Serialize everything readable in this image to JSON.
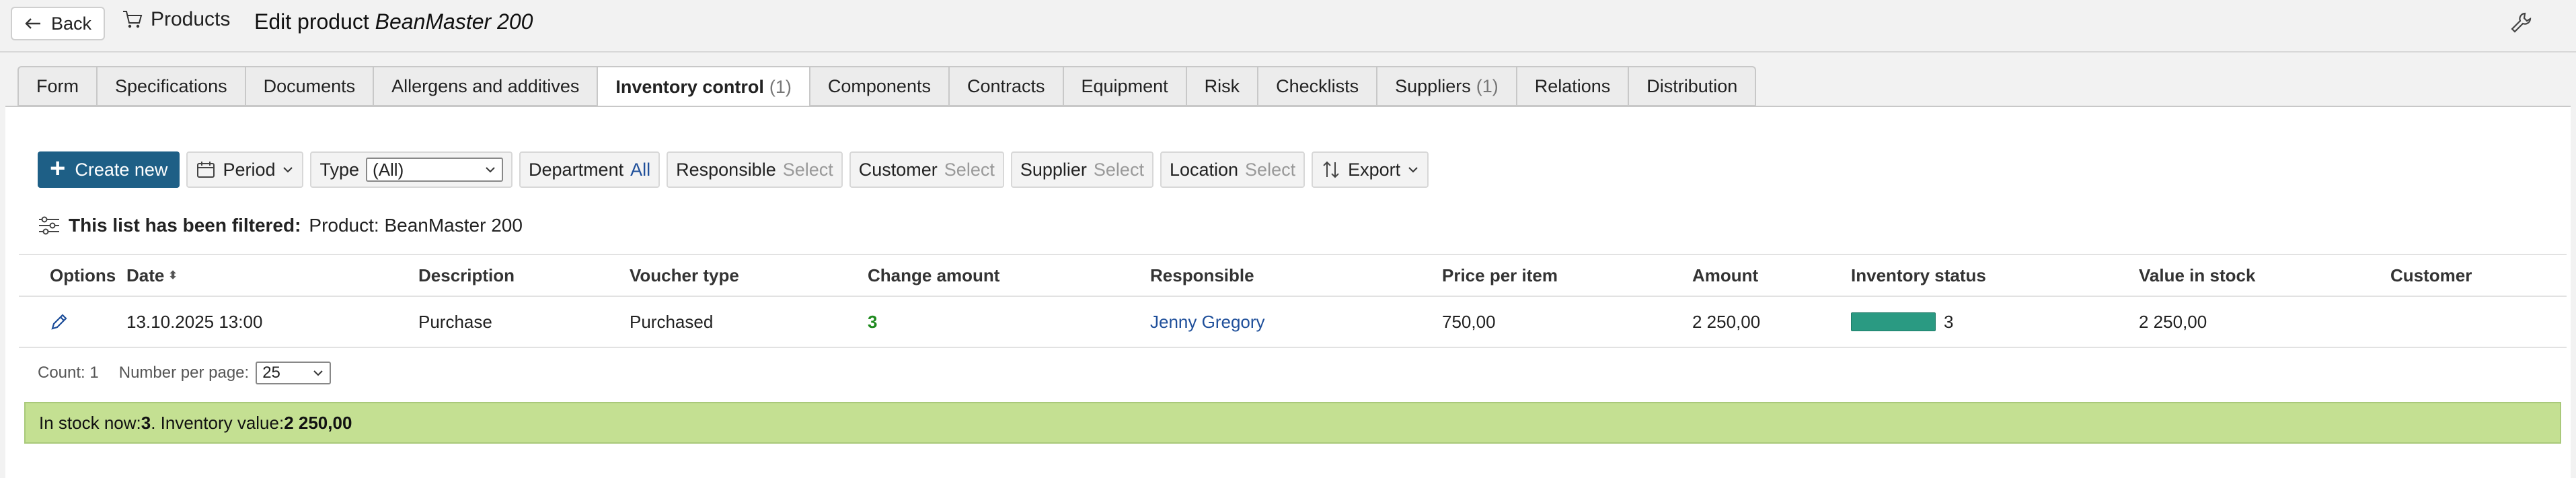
{
  "header": {
    "back_label": "Back",
    "breadcrumb": "Products",
    "title_prefix": "Edit product",
    "title_product": "BeanMaster 200"
  },
  "tabs": [
    {
      "label": "Form",
      "count": ""
    },
    {
      "label": "Specifications",
      "count": ""
    },
    {
      "label": "Documents",
      "count": ""
    },
    {
      "label": "Allergens and additives",
      "count": ""
    },
    {
      "label": "Inventory control",
      "count": "(1)",
      "active": true
    },
    {
      "label": "Components",
      "count": ""
    },
    {
      "label": "Contracts",
      "count": ""
    },
    {
      "label": "Equipment",
      "count": ""
    },
    {
      "label": "Risk",
      "count": ""
    },
    {
      "label": "Checklists",
      "count": ""
    },
    {
      "label": "Suppliers",
      "count": "(1)"
    },
    {
      "label": "Relations",
      "count": ""
    },
    {
      "label": "Distribution",
      "count": ""
    }
  ],
  "toolbar": {
    "create_label": "Create new",
    "period_label": "Period",
    "type_label": "Type",
    "type_value": "(All)",
    "department_label": "Department",
    "department_value": "All",
    "responsible_label": "Responsible",
    "responsible_value": "Select",
    "customer_label": "Customer",
    "customer_value": "Select",
    "supplier_label": "Supplier",
    "supplier_value": "Select",
    "location_label": "Location",
    "location_value": "Select",
    "export_label": "Export"
  },
  "filter_notice": {
    "label": "This list has been filtered:",
    "value": "Product: BeanMaster 200"
  },
  "table": {
    "headers": {
      "options": "Options",
      "date": "Date",
      "description": "Description",
      "voucher_type": "Voucher type",
      "change_amount": "Change amount",
      "responsible": "Responsible",
      "price_per_item": "Price per item",
      "amount": "Amount",
      "inventory_status": "Inventory status",
      "value_in_stock": "Value in stock",
      "customer": "Customer"
    },
    "rows": [
      {
        "date": "13.10.2025 13:00",
        "description": "Purchase",
        "voucher_type": "Purchased",
        "change_amount": "3",
        "responsible": "Jenny Gregory",
        "price_per_item": "750,00",
        "amount": "2 250,00",
        "inventory_status": "3",
        "value_in_stock": "2 250,00",
        "customer": ""
      }
    ]
  },
  "pager": {
    "count_text": "Count: 1",
    "per_page_label": "Number per page:",
    "per_page_value": "25"
  },
  "summary": {
    "prefix": "In stock now: ",
    "stock": "3",
    "middle": ". Inventory value: ",
    "value": "2 250,00"
  },
  "colors": {
    "primary_button": "#1e5f86",
    "summary_bg": "#c4e092",
    "inventory_bar": "#2a9a82",
    "link": "#1f4f9a",
    "positive_change": "#1f8a1f"
  }
}
